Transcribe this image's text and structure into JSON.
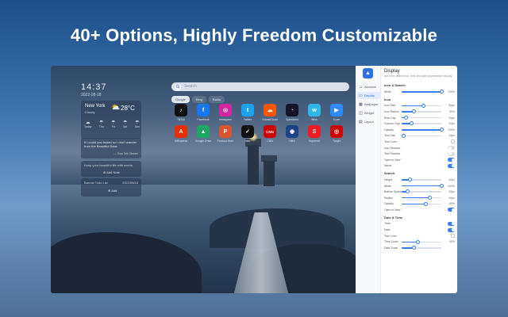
{
  "headline": "40+ Options, Highly Freedom Customizable",
  "clock": {
    "time": "14:37",
    "date": "2022-08-18"
  },
  "weather": {
    "city": "New York",
    "condition": "Cloudy",
    "temperature": "28°C",
    "days": [
      {
        "label": "Today",
        "icon": "cloud-icon"
      },
      {
        "label": "Thu",
        "icon": "rain-icon"
      },
      {
        "label": "Fri",
        "icon": "rain-icon"
      },
      {
        "label": "Sat",
        "icon": "rain-icon"
      },
      {
        "label": "Sun",
        "icon": "rain-icon"
      }
    ]
  },
  "quote": {
    "text": "If I could you fooled so I don't wander from the Beautiful Solar",
    "author": "— Sina Talk Stream"
  },
  "note": {
    "placeholder": "Keep your beautiful life with words.",
    "add_label": "Add Note"
  },
  "todo": {
    "title": "Barrow Todo List",
    "date": "2022/08/18",
    "add_label": "Add"
  },
  "search": {
    "placeholder": "Search"
  },
  "tabs": [
    {
      "label": "Google",
      "active": true
    },
    {
      "label": "Bing",
      "active": false
    },
    {
      "label": "Baidu",
      "active": false
    }
  ],
  "apps": [
    {
      "label": "TikTok",
      "color": "#111111",
      "glyph": "♪"
    },
    {
      "label": "Facebook",
      "color": "#1877f2",
      "glyph": "f"
    },
    {
      "label": "Instagram",
      "color": "#d6249f",
      "glyph": "◎"
    },
    {
      "label": "Twitter",
      "color": "#1da1f2",
      "glyph": "t"
    },
    {
      "label": "SoundCloud",
      "color": "#ff5500",
      "glyph": "☁"
    },
    {
      "label": "Speedtest",
      "color": "#141526",
      "glyph": "◔"
    },
    {
      "label": "Wish",
      "color": "#2fb7ec",
      "glyph": "w"
    },
    {
      "label": "Zoom",
      "color": "#2d8cff",
      "glyph": "▶"
    },
    {
      "label": "AliExpress",
      "color": "#e62e04",
      "glyph": "A"
    },
    {
      "label": "Google Drive",
      "color": "#1fa463",
      "glyph": "▲"
    },
    {
      "label": "Product Hunt",
      "color": "#da552f",
      "glyph": "P"
    },
    {
      "label": "Nike",
      "color": "#111111",
      "glyph": "✓"
    },
    {
      "label": "CNN",
      "color": "#cc0000",
      "glyph": "CNN"
    },
    {
      "label": "NBA",
      "color": "#1d428a",
      "glyph": "◉"
    },
    {
      "label": "Supreme",
      "color": "#ed1c24",
      "glyph": "S"
    },
    {
      "label": "Target",
      "color": "#cc0000",
      "glyph": "◎"
    }
  ],
  "settings": {
    "title": "Display",
    "subtitle": "Set icon, search bar, time and date appearance display",
    "nav": [
      {
        "label": "Account",
        "icon": "user-icon",
        "active": false
      },
      {
        "label": "Display",
        "icon": "display-icon",
        "active": true
      },
      {
        "label": "Wallpaper",
        "icon": "image-icon",
        "active": false
      },
      {
        "label": "Widget",
        "icon": "widget-icon",
        "active": false
      },
      {
        "label": "Layout",
        "icon": "layout-icon",
        "active": false
      }
    ],
    "sections": [
      {
        "title": "Icon & Search",
        "rows": [
          {
            "label": "Width",
            "type": "slider",
            "value": "100%",
            "level": 1.0
          }
        ]
      },
      {
        "title": "Icon",
        "rows": [
          {
            "label": "Icon Size",
            "type": "slider",
            "value": "80px",
            "level": 0.55
          },
          {
            "label": "Icon Radius",
            "type": "slider",
            "value": "30%",
            "level": 0.3
          },
          {
            "label": "Row Gap",
            "type": "slider",
            "value": "20px",
            "level": 0.1
          },
          {
            "label": "Column Gap",
            "type": "slider",
            "value": "20px",
            "level": 0.25
          },
          {
            "label": "Opacity",
            "type": "slider",
            "value": "100%",
            "level": 1.0
          },
          {
            "label": "Text Size",
            "type": "slider",
            "value": "12px",
            "level": 0.05
          },
          {
            "label": "Text Color",
            "type": "checkbox",
            "checked": false
          },
          {
            "label": "Icon Shadow",
            "type": "toggle",
            "on": false
          },
          {
            "label": "Text Shadow",
            "type": "toggle",
            "on": false
          },
          {
            "label": "Open in New Tab",
            "type": "toggle",
            "on": true
          },
          {
            "label": "Name",
            "type": "toggle",
            "on": true
          }
        ]
      },
      {
        "title": "Search",
        "rows": [
          {
            "label": "Height",
            "type": "slider",
            "value": "40px",
            "level": 0.2
          },
          {
            "label": "Width",
            "type": "slider",
            "value": "100%",
            "level": 1.0
          },
          {
            "label": "Bottom Space",
            "type": "slider",
            "value": "20px",
            "level": 0.15
          },
          {
            "label": "Radius",
            "type": "slider",
            "value": "20px",
            "level": 0.7
          },
          {
            "label": "Opacity",
            "type": "slider",
            "value": "60%",
            "level": 0.6
          },
          {
            "label": "Open in New Tab",
            "type": "toggle",
            "on": true
          }
        ]
      },
      {
        "title": "Date & Time",
        "rows": [
          {
            "label": "Time",
            "type": "toggle",
            "on": true
          },
          {
            "label": "Date",
            "type": "toggle",
            "on": true
          },
          {
            "label": "Text Color",
            "type": "checkbox",
            "checked": false
          },
          {
            "label": "Time Zoom",
            "type": "slider",
            "value": "40%",
            "level": 0.4
          },
          {
            "label": "Date Zoom",
            "type": "slider",
            "value": "",
            "level": 0.3
          }
        ]
      }
    ]
  }
}
